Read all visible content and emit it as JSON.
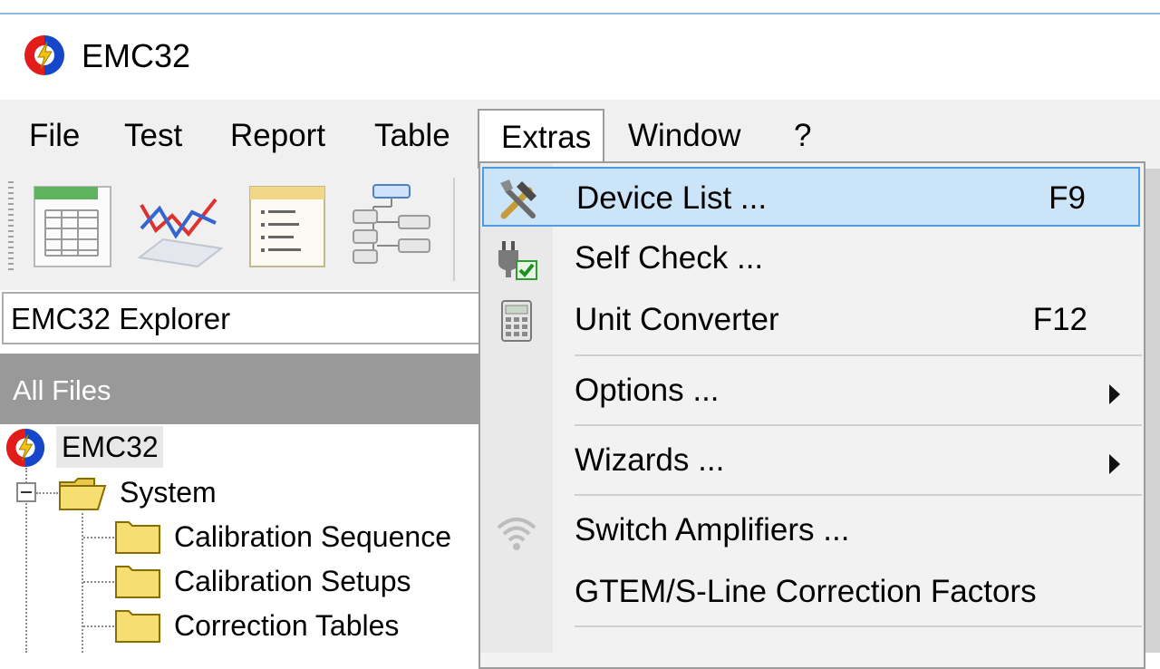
{
  "window": {
    "title": "EMC32"
  },
  "menubar": {
    "items": [
      {
        "label": "File"
      },
      {
        "label": "Test"
      },
      {
        "label": "Report"
      },
      {
        "label": "Table"
      },
      {
        "label": "Extras"
      },
      {
        "label": "Window"
      },
      {
        "label": "?"
      }
    ],
    "open_menu": "Extras"
  },
  "toolbar": {
    "buttons": [
      {
        "icon": "table-icon"
      },
      {
        "icon": "line-graph-icon"
      },
      {
        "icon": "report-list-icon"
      },
      {
        "icon": "hierarchy-icon"
      }
    ]
  },
  "explorer": {
    "title": "EMC32 Explorer",
    "filter_label": "All Files",
    "tree": {
      "root": "EMC32",
      "system": "System",
      "children": [
        "Calibration Sequence",
        "Calibration Setups",
        "Correction Tables"
      ]
    }
  },
  "extras_menu": {
    "items": [
      {
        "label": "Device List ...",
        "shortcut": "F9",
        "icon": "tools-icon",
        "highlighted": true
      },
      {
        "label": "Self Check ...",
        "shortcut": "",
        "icon": "plug-check-icon"
      },
      {
        "label": "Unit Converter",
        "shortcut": "F12",
        "icon": "calculator-icon"
      },
      {
        "label": "Options ...",
        "shortcut": "",
        "submenu": true
      },
      {
        "label": "Wizards ...",
        "shortcut": "",
        "submenu": true
      },
      {
        "label": "Switch Amplifiers ...",
        "shortcut": "",
        "icon": "wireless-icon"
      },
      {
        "label": "GTEM/S-Line Correction Factors",
        "shortcut": ""
      }
    ]
  },
  "colors": {
    "highlight_bg": "#cce4f7",
    "highlight_border": "#4a9de2",
    "allfiles_bar": "#999999"
  }
}
